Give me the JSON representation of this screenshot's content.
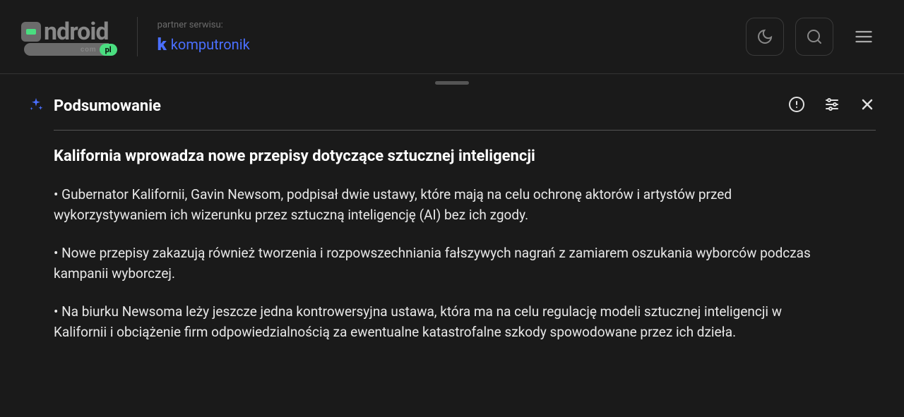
{
  "header": {
    "logo_text": "ndroid",
    "logo_com": "com",
    "logo_pl": "pl",
    "partner_label": "partner serwisu:",
    "partner_name": "komputronik"
  },
  "panel": {
    "title": "Podsumowanie"
  },
  "article": {
    "title": "Kalifornia wprowadza nowe przepisy dotyczące sztucznej inteligencji",
    "bullets": [
      "• Gubernator Kalifornii, Gavin Newsom, podpisał dwie ustawy, które mają na celu ochronę aktorów i artystów przed wykorzystywaniem ich wizerunku przez sztuczną inteligencję (AI) bez ich zgody.",
      "• Nowe przepisy zakazują również tworzenia i rozpowszechniania fałszywych nagrań z zamiarem oszukania wyborców podczas kampanii wyborczej.",
      "• Na biurku Newsoma leży jeszcze jedna kontrowersyjna ustawa, która ma na celu regulację modeli sztucznej inteligencji w Kalifornii i obciążenie firm odpowiedzialnością za ewentualne katastrofalne szkody spowodowane przez ich dzieła."
    ]
  }
}
